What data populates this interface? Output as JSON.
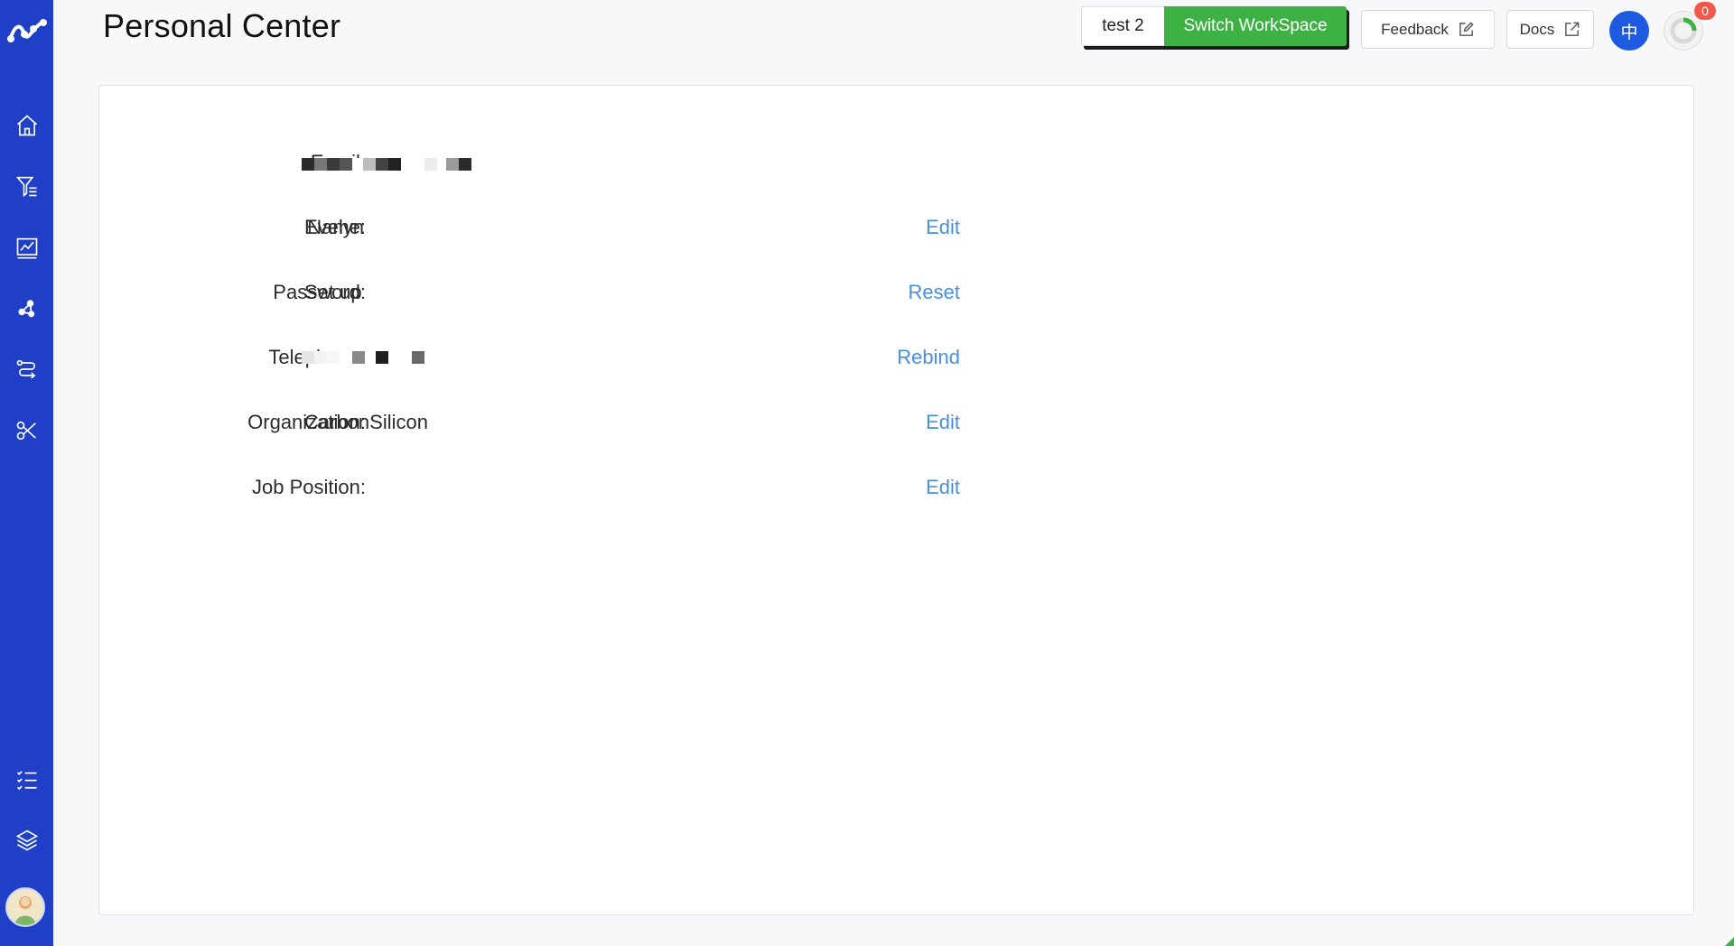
{
  "sidebar": {
    "logo": "logo-icon",
    "items": [
      {
        "icon": "home-icon"
      },
      {
        "icon": "filter-icon"
      },
      {
        "icon": "chart-icon"
      },
      {
        "icon": "molecule-icon"
      },
      {
        "icon": "workflow-icon"
      },
      {
        "icon": "tools-icon"
      },
      {
        "icon": "task-list-icon"
      },
      {
        "icon": "layers-icon"
      }
    ],
    "avatar": "avatar"
  },
  "header": {
    "title": "Personal Center",
    "workspace_name": "test 2",
    "switch_label": "Switch WorkSpace",
    "feedback_label": "Feedback",
    "docs_label": "Docs",
    "language_label": "中",
    "notification_count": "0",
    "colors": {
      "accent": "#1f3fc6",
      "switch": "#3db144",
      "badge": "#f15a4a",
      "link": "#4a8ee0"
    }
  },
  "profile": {
    "email": {
      "label": "Email:"
    },
    "name": {
      "label": "Name:",
      "value": "Evelyn",
      "action": "Edit"
    },
    "password": {
      "label": "Password:",
      "value": "Set up",
      "action": "Reset"
    },
    "telephone": {
      "label": "Telephone:",
      "action": "Rebind"
    },
    "organization": {
      "label": "Organization:",
      "value": "CarbonSilicon",
      "action": "Edit"
    },
    "job_position": {
      "label": "Job Position:",
      "value": "",
      "action": "Edit"
    }
  }
}
